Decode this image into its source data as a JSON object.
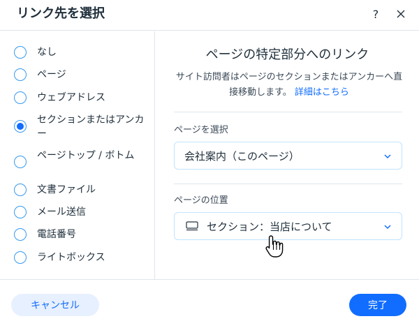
{
  "header": {
    "title": "リンク先を選択",
    "help_label": "?"
  },
  "options": [
    {
      "label": "なし",
      "selected": false
    },
    {
      "label": "ページ",
      "selected": false
    },
    {
      "label": "ウェブアドレス",
      "selected": false
    },
    {
      "label": "セクションまたはアンカー",
      "selected": true
    },
    {
      "label": "ページトップ / ボトム",
      "selected": false
    },
    {
      "label": "文書ファイル",
      "selected": false
    },
    {
      "label": "メール送信",
      "selected": false
    },
    {
      "label": "電話番号",
      "selected": false
    },
    {
      "label": "ライトボックス",
      "selected": false
    }
  ],
  "panel": {
    "title": "ページの特定部分へのリンク",
    "description": "サイト訪問者はページのセクションまたはアンカーへ直接移動します。",
    "learn_more": "詳細はこちら",
    "page_select_label": "ページを選択",
    "page_select_value": "会社案内（このページ）",
    "position_label": "ページの位置",
    "position_value": "セクション：当店について"
  },
  "footer": {
    "cancel_label": "キャンセル",
    "done_label": "完了"
  },
  "colors": {
    "accent": "#116dff",
    "text": "#20303c",
    "border": "#dfe5eb",
    "cancel_bg": "#e7f0ff"
  },
  "icons": [
    "help-icon",
    "close-icon",
    "chevron-down-icon",
    "section-icon",
    "hand-cursor-icon"
  ]
}
